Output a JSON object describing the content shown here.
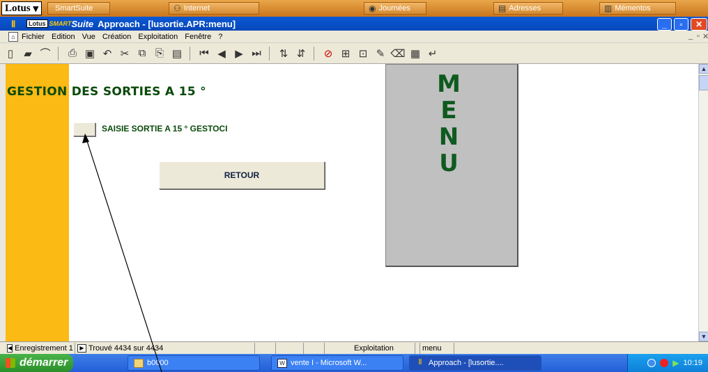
{
  "suite_bar": {
    "logo": "Lotus",
    "tabs": [
      {
        "label": "SmartSuite",
        "icon": "smartsuite-icon"
      },
      {
        "label": "Internet",
        "icon": "internet-icon"
      },
      {
        "label": "Journées",
        "icon": "calendar-icon"
      },
      {
        "label": "Adresses",
        "icon": "address-book-icon"
      },
      {
        "label": "Mémentos",
        "icon": "notes-icon"
      }
    ]
  },
  "title_bar": {
    "lotus_badge": "Lotus",
    "smart_badge": "SMART",
    "suite_badge": "Suite",
    "title": "Approach - [lusortie.APR:menu]"
  },
  "menu_bar": {
    "items": [
      "Fichier",
      "Edition",
      "Vue",
      "Création",
      "Exploitation",
      "Fenêtre",
      "?"
    ]
  },
  "form": {
    "title": "GESTION DES SORTIES A 15 °",
    "saisie_label": "SAISIE SORTIE A 15 ° GESTOCI",
    "retour_label": "RETOUR",
    "menu_letters": [
      "M",
      "E",
      "N",
      "U"
    ]
  },
  "status_bar": {
    "record": "Enregistrement 1",
    "found": "Trouvé 4434 sur 4434",
    "mode": "Exploitation",
    "view": "menu"
  },
  "taskbar": {
    "start": "démarrer",
    "tasks": [
      {
        "label": "b0000",
        "icon": "folder-icon"
      },
      {
        "label": "vente I - Microsoft W...",
        "icon": "word-icon"
      },
      {
        "label": "Approach - [lusortie....",
        "icon": "approach-icon"
      }
    ],
    "clock": "10:19"
  },
  "colors": {
    "accent_yellow": "#fcba14",
    "title_green": "#0b4a0b",
    "menu_panel": "#c0c0c0",
    "xp_blue": "#245ed8"
  }
}
